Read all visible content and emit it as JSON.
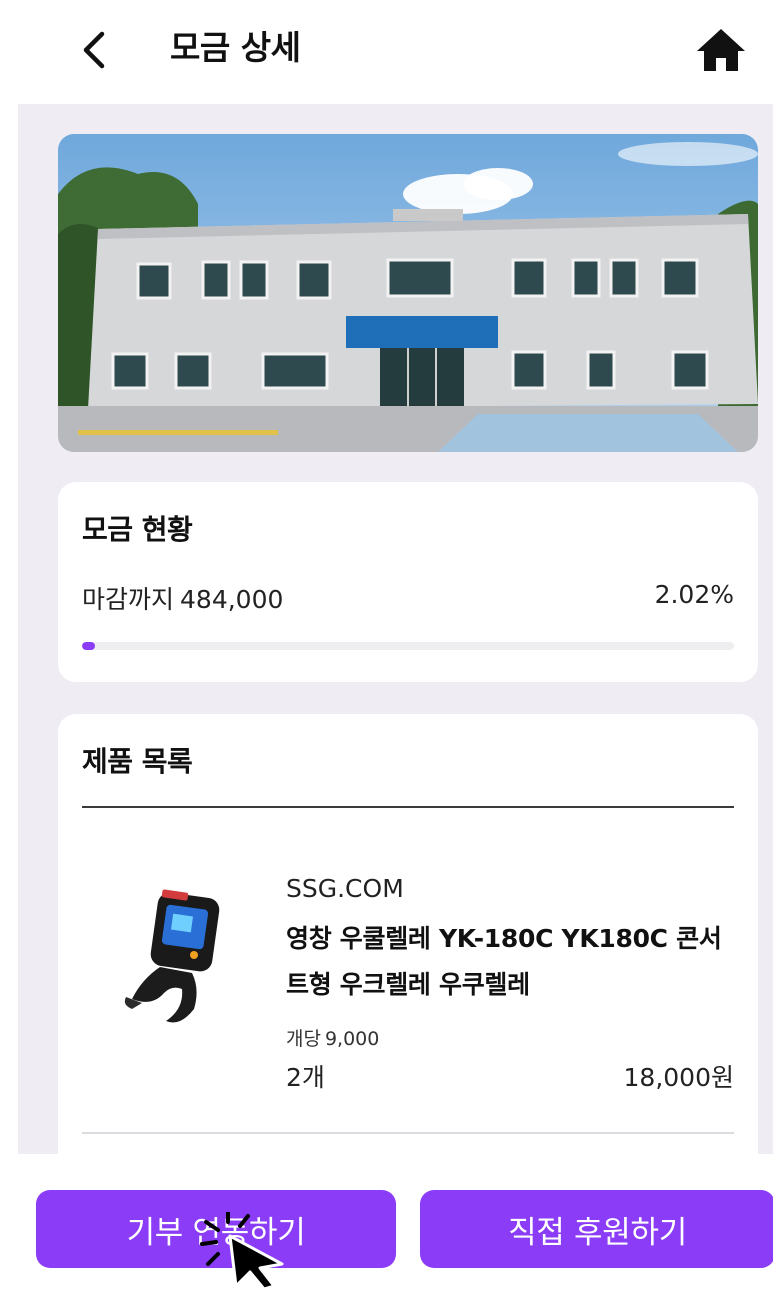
{
  "header": {
    "title": "모금 상세",
    "back_icon": "chevron-left-icon",
    "home_icon": "home-icon"
  },
  "status": {
    "title": "모금 현황",
    "remaining_label": "마감까지",
    "remaining_amount": "484,000",
    "percent_text": "2.02%",
    "progress_percent": 2.02
  },
  "products": {
    "title": "제품 목록",
    "items": [
      {
        "vendor": "SSG.COM",
        "name": "영창 우쿨렐레 YK-180C YK180C 콘서트형 우크렐레 우쿠렐레",
        "unit_label": "개당",
        "unit_price": "9,000",
        "quantity": "2개",
        "total": "18,000원"
      }
    ]
  },
  "actions": {
    "link_donation": "기부 연동하기",
    "direct_support": "직접 후원하기"
  },
  "colors": {
    "accent": "#8b3cf7",
    "background": "#efedf3",
    "card": "#ffffff"
  }
}
